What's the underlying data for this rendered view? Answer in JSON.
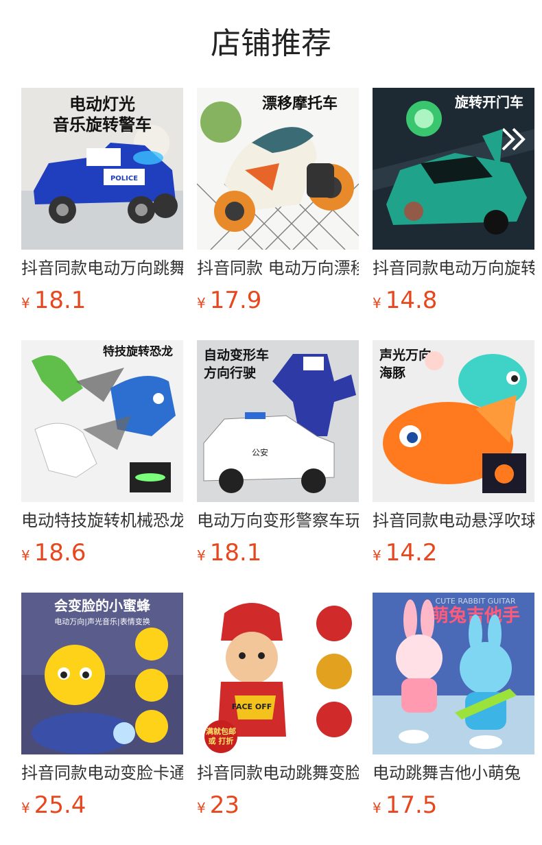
{
  "header": {
    "title": "店铺推荐"
  },
  "currency_symbol": "¥",
  "products": [
    {
      "name": "抖音同款电动万向跳舞警车",
      "price": "18.1",
      "image_text": [
        "电动灯光",
        "音乐旋转警车"
      ],
      "image_label": "POLICE"
    },
    {
      "name": "抖音同款 电动万向漂移摩托车",
      "price": "17.9",
      "image_text": [
        "漂移摩托车"
      ]
    },
    {
      "name": "抖音同款电动万向旋转开门车",
      "price": "14.8",
      "image_text": [
        "旋转开门车"
      ]
    },
    {
      "name": "电动特技旋转机械恐龙",
      "price": "18.6",
      "image_text": [
        "特技旋转恐龙"
      ]
    },
    {
      "name": "电动万向变形警察车玩具",
      "price": "18.1",
      "image_text": [
        "自动变形车",
        "方向行驶"
      ],
      "image_label": "公安"
    },
    {
      "name": "抖音同款电动悬浮吹球海豚",
      "price": "14.2",
      "image_text": [
        "声光万向",
        "海豚"
      ]
    },
    {
      "name": "抖音同款电动变脸卡通小蜜蜂",
      "price": "25.4",
      "image_text": [
        "会变脸的小蜜蜂",
        "电动万向|声光音乐|表情变换"
      ]
    },
    {
      "name": "抖音同款电动跳舞变脸玩具",
      "price": "23",
      "image_text": [
        "满就包邮",
        "或 打折"
      ],
      "image_label": "FACE OFF"
    },
    {
      "name": "电动跳舞吉他小萌兔",
      "price": "17.5",
      "image_text": [
        "萌兔吉他手"
      ],
      "image_label": "CUTE RABBIT GUITAR"
    }
  ],
  "colors": {
    "price": "#e8461d",
    "title": "#222222",
    "name": "#333333"
  }
}
